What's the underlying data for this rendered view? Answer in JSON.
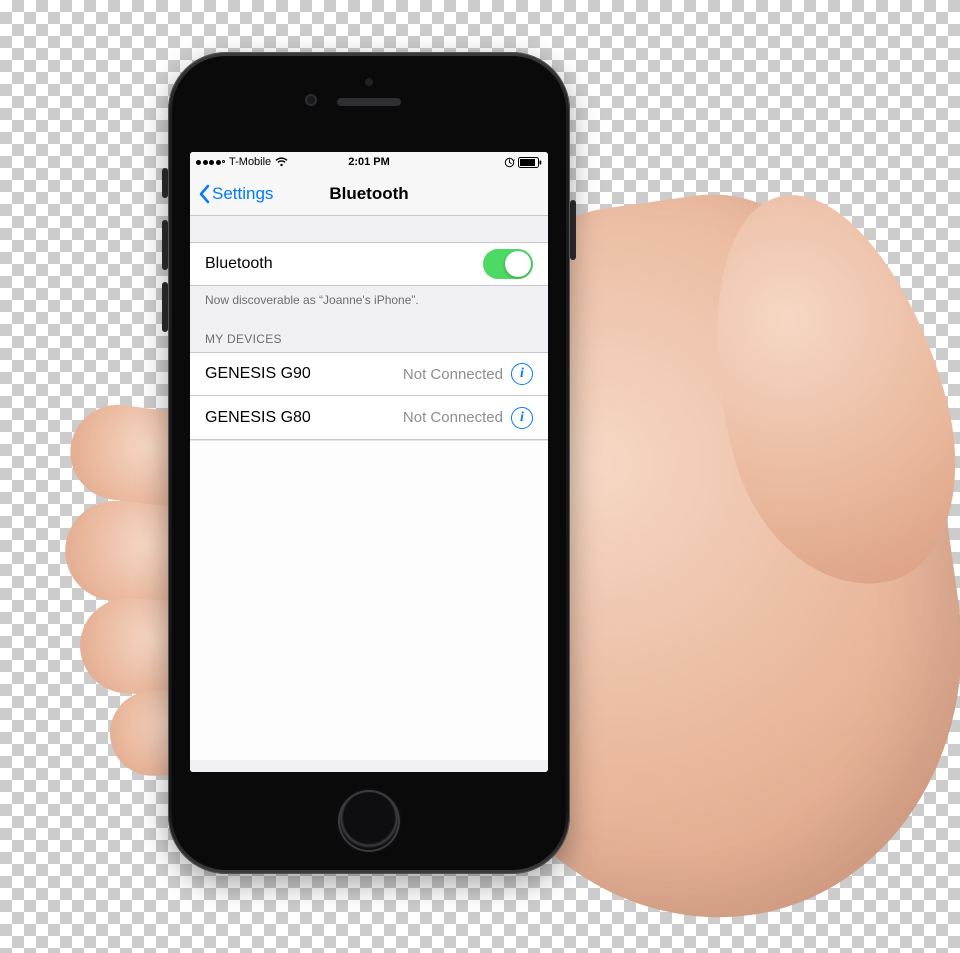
{
  "status_bar": {
    "carrier": "T-Mobile",
    "time": "2:01 PM",
    "signal_strength": 4,
    "wifi": true,
    "rotation_lock": true,
    "battery_level": 85
  },
  "nav": {
    "back_label": "Settings",
    "title": "Bluetooth"
  },
  "bluetooth": {
    "toggle_label": "Bluetooth",
    "enabled": true,
    "discoverable_note": "Now discoverable as “Joanne's iPhone”."
  },
  "my_devices": {
    "header": "MY DEVICES",
    "items": [
      {
        "name": "GENESIS G90",
        "status": "Not Connected"
      },
      {
        "name": "GENESIS G80",
        "status": "Not Connected"
      }
    ]
  },
  "colors": {
    "ios_blue": "#007aff",
    "ios_green": "#4cd964",
    "bg_grouped": "#efeff4",
    "secondary_text": "#8e8e93"
  }
}
